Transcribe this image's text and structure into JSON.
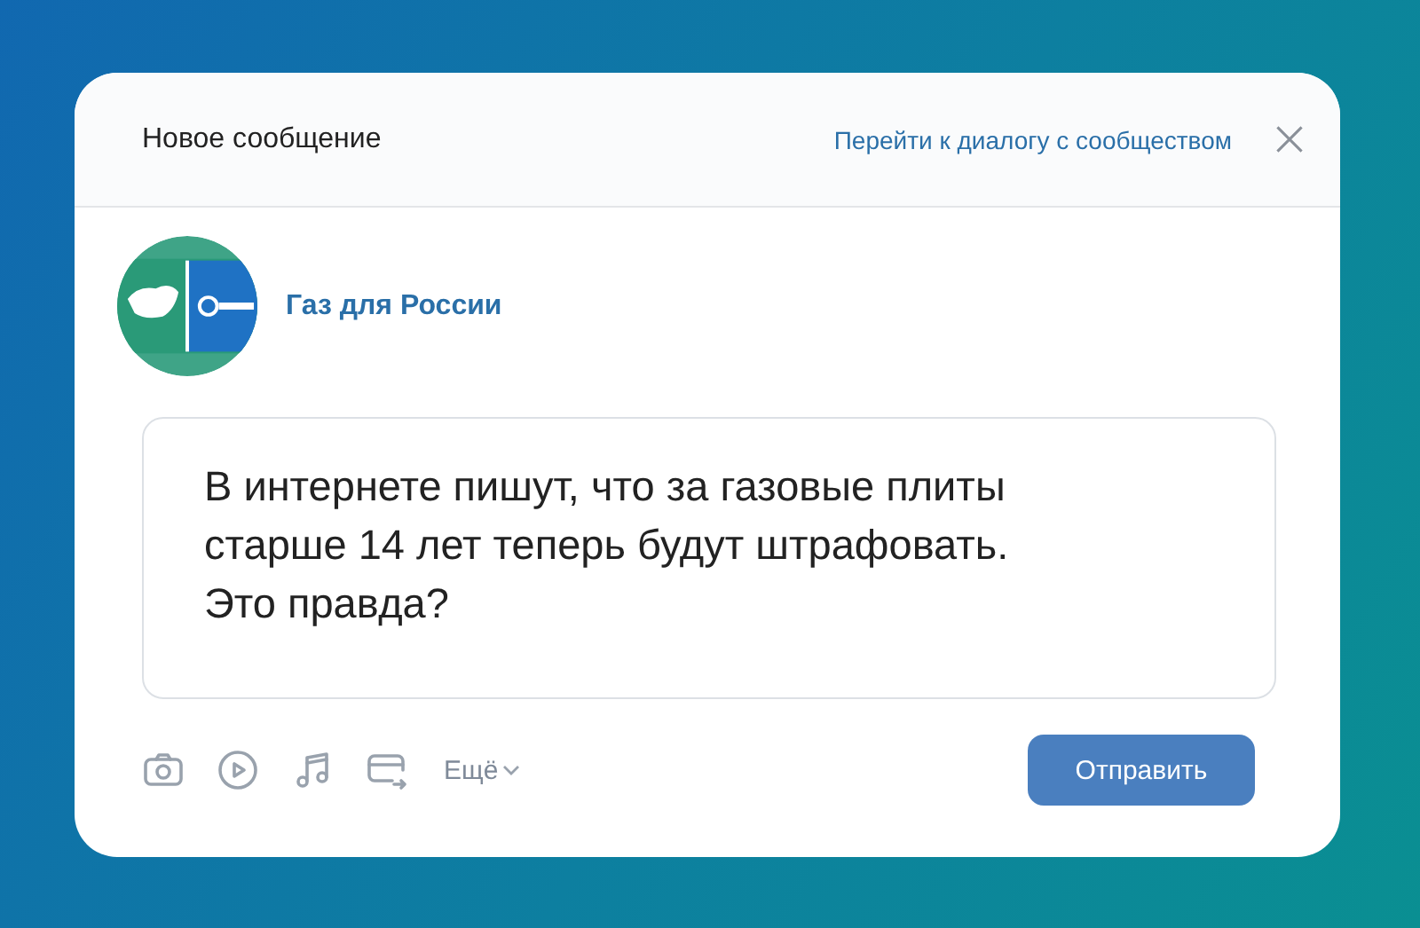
{
  "dialog": {
    "title": "Новое сообщение",
    "link": "Перейти к диалогу с сообществом"
  },
  "community": {
    "name": "Газ для России"
  },
  "message": {
    "value": "В интернете пишут, что за газовые плиты\nстарше 14 лет теперь будут штрафовать.\nЭто правда?"
  },
  "toolbar": {
    "attachments": [
      {
        "kind": "photo"
      },
      {
        "kind": "video"
      },
      {
        "kind": "music"
      },
      {
        "kind": "card"
      }
    ],
    "more": "Ещё"
  },
  "send_button": "Отправить"
}
